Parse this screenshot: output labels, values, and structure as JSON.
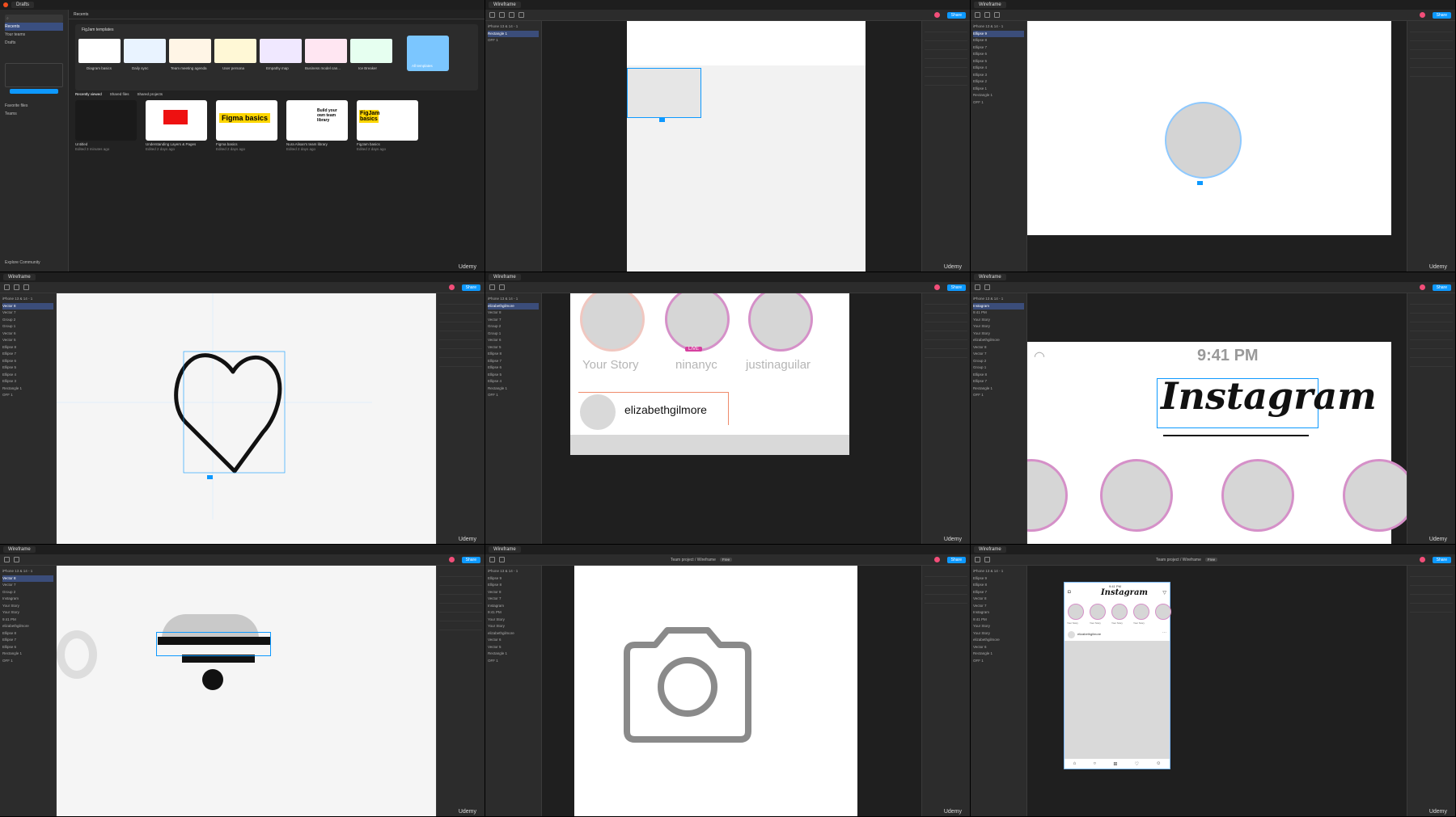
{
  "app": {
    "home_tab": "Drafts",
    "file_tab": "Wireframe",
    "share_label": "Share",
    "watermark": "Udemy",
    "project_path": "Team project / Wireframe",
    "project_badge": "Free"
  },
  "home": {
    "sidebar": [
      "Recents",
      "Your teams",
      "Drafts"
    ],
    "favorites": "Favorite files",
    "teams": "Teams",
    "explore": "Explore Community",
    "templates_heading": "FigJam templates",
    "templates": [
      "Diagram basics",
      "Daily sync",
      "Team meeting agenda",
      "User persona",
      "Empathy map",
      "Business model can...",
      "Ice Breaker"
    ],
    "browse_all": "All templates",
    "recent_tabs": [
      "Recently viewed",
      "Shared files",
      "Shared projects"
    ],
    "files": [
      {
        "name": "Untitled",
        "meta": "Edited 3 minutes ago"
      },
      {
        "name": "Understanding Layers & Pages",
        "meta": "Edited 2 days ago"
      },
      {
        "name": "Figma basics",
        "meta": "Edited 2 days ago"
      },
      {
        "name": "Nura Alisan's team library",
        "meta": "Edited 2 days ago"
      },
      {
        "name": "FigJam basics",
        "meta": "Edited 2 days ago"
      }
    ],
    "figma_basics_text": "Figma basics",
    "library_text": "Build your own team library",
    "figjam_text": "FigJam basics"
  },
  "layers": {
    "page": "iPhone 13 & 14 - 1",
    "items_a": [
      "Rectangle 1",
      "OFF 1"
    ],
    "items_b": [
      "Ellipse 9",
      "Ellipse 8",
      "Ellipse 7",
      "Ellipse 6",
      "Ellipse 5",
      "Ellipse 4",
      "Ellipse 3",
      "Ellipse 2",
      "Ellipse 1",
      "Rectangle 1",
      "OFF 1"
    ],
    "items_c": [
      "Vector 8",
      "Vector 7",
      "Group 2",
      "Group 1",
      "Vector 6",
      "Vector 5",
      "Ellipse 8",
      "Ellipse 7",
      "Ellipse 6",
      "Ellipse 5",
      "Ellipse 4",
      "Ellipse 3",
      "Rectangle 1",
      "OFF 1"
    ],
    "items_d": [
      "elizabethgilmore",
      "Vector 8",
      "Vector 7",
      "Group 2",
      "Group 1",
      "Vector 6",
      "Vector 5",
      "Ellipse 8",
      "Ellipse 7",
      "Ellipse 6",
      "Ellipse 5",
      "Ellipse 4",
      "Rectangle 1",
      "OFF 1"
    ],
    "items_e": [
      "Instagram",
      "9:41 PM",
      "Your Story",
      "Your Story",
      "Your Story",
      "elizabethgilmore",
      "Vector 8",
      "Vector 7",
      "Group 2",
      "Group 1",
      "Ellipse 8",
      "Ellipse 7",
      "Rectangle 1",
      "OFF 1"
    ]
  },
  "stories": {
    "names": [
      "Your Story",
      "ninanyc",
      "justinaguilar"
    ],
    "user": "elizabethgilmore",
    "time": "9:41 PM",
    "logo": "Instagram",
    "live": "LIVE"
  },
  "phone": {
    "time": "9:41 PM",
    "logo": "Instagram",
    "stories": [
      "Your Story",
      "Your Story",
      "Your Story",
      "Your Story",
      "Your Story"
    ],
    "user": "elizabethgilmore"
  },
  "colors": {
    "accent": "#0d99ff",
    "story_ring": "#d590c8",
    "avatar": "#f24e79"
  }
}
